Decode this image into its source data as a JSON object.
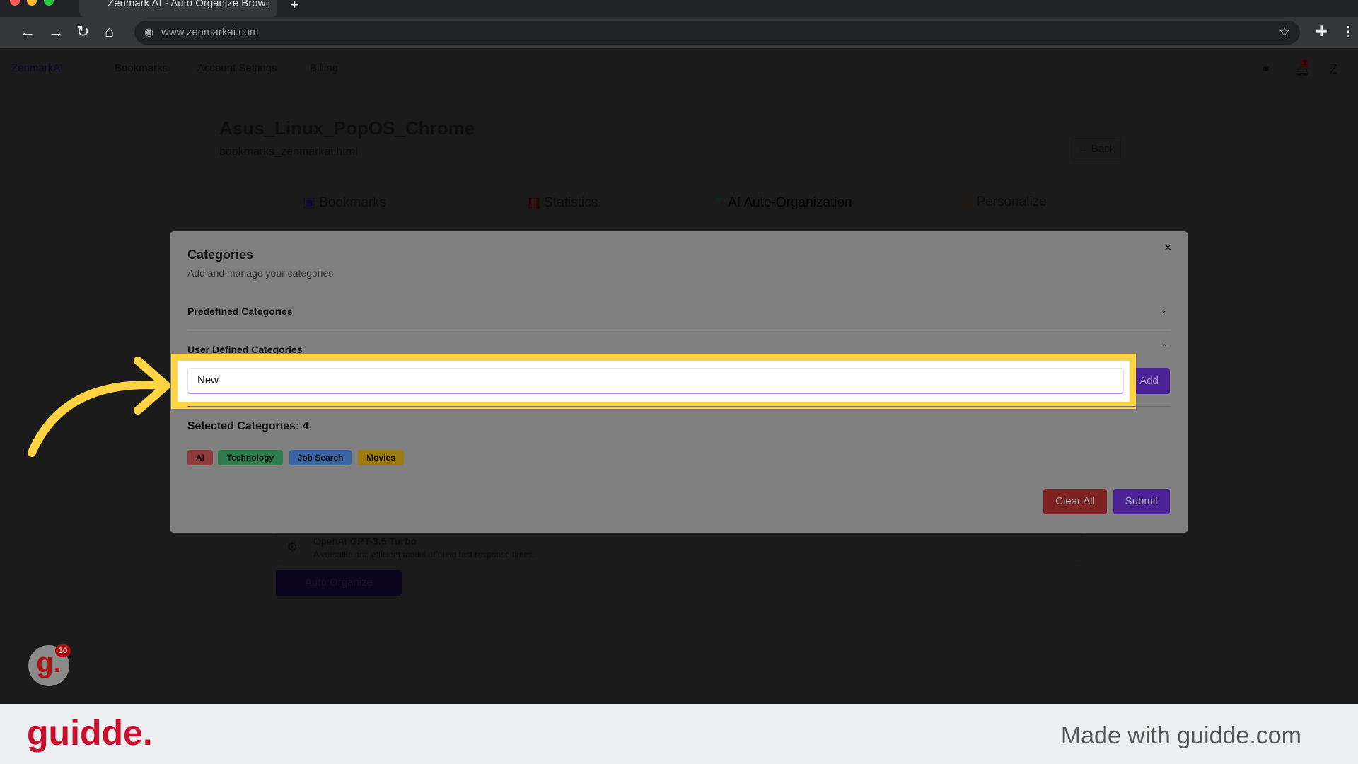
{
  "browser": {
    "tab_title": "Zenmark AI - Auto Organize Brow:",
    "url": "www.zenmarkai.com"
  },
  "nav": {
    "logo": "ZenmarkAI",
    "items": [
      "Bookmarks",
      "Account Settings",
      "Billing"
    ],
    "notification_count": "3",
    "avatar_letter": "Z"
  },
  "page": {
    "title": "Asus_Linux_PopOS_Chrome",
    "file": "bookmarks_zenmarkai.html",
    "back": "Back",
    "tabs": [
      "Bookmarks",
      "Statistics",
      "AI Auto-Organization",
      "Personalize"
    ],
    "model_vendor": "OpenAI",
    "model_name": "GPT-3.5 Turbo",
    "model_desc": "A versatile and efficient model offering fast response times.",
    "auto_organize": "Auto Organize"
  },
  "modal": {
    "title": "Categories",
    "subtitle": "Add and manage your categories",
    "predefined": "Predefined Categories",
    "user_defined": "User Defined Categories",
    "input_value": "New",
    "add": "Add",
    "selected_label": "Selected Categories: 4",
    "chips": [
      {
        "label": "AI",
        "color": "#8e3b3b"
      },
      {
        "label": "Technology",
        "color": "#2f7d4c"
      },
      {
        "label": "Job Search",
        "color": "#3b66a3"
      },
      {
        "label": "Movies",
        "color": "#9c7c12"
      }
    ],
    "clear_all": "Clear All",
    "submit": "Submit"
  },
  "overlay": {
    "badge": "30"
  },
  "footer": {
    "brand": "guidde.",
    "made_with": "Made with guidde.com"
  },
  "colors": {
    "highlight": "#ffd342",
    "accent": "#4b2196",
    "danger": "#7f2222",
    "brand": "#c8102e"
  }
}
